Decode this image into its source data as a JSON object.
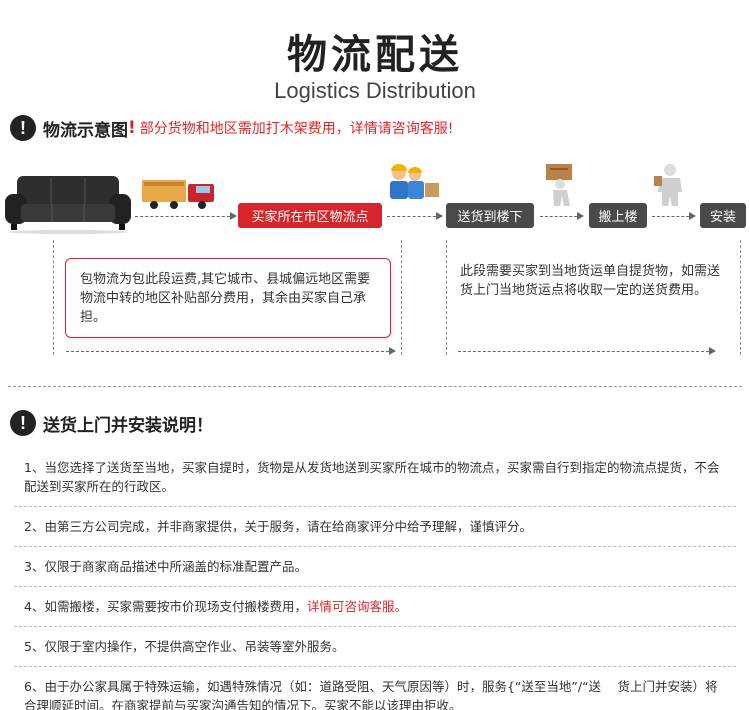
{
  "header": {
    "title": "物流配送",
    "subtitle": "Logistics Distribution"
  },
  "section1": {
    "title": "物流示意图",
    "exclaim": "!",
    "note": "部分货物和地区需加打木架费用，详情请咨询客服!"
  },
  "flow": {
    "step1": "买家所在市区物流点",
    "step2": "送货到楼下",
    "step3": "搬上楼",
    "step4": "安装"
  },
  "left_box": {
    "text": "包物流为包此段运费,其它城市、县城偏远地区需要物流中转的地区补贴部分费用，其余由买家自己承担。"
  },
  "right_box": {
    "text": "此段需要买家到当地货运单自提货物，如需送货上门当地货运点将收取一定的送货费用。"
  },
  "section2": {
    "title": "送货上门并安装说明！"
  },
  "notes": [
    {
      "text": "1、当您选择了送货至当地，买家自提时，货物是从发货地送到买家所在城市的物流点，买家需自行到指定的物流点提货，不会配送到买家所在的行政区。"
    },
    {
      "text": "2、由第三方公司完成，并非商家提供，关于服务，请在给商家评分中给予理解，谨慎评分。"
    },
    {
      "text": "3、仅限于商家商品描述中所涵盖的标准配置产品。"
    },
    {
      "text": "4、如需搬楼，买家需要按市价现场支付搬楼费用，",
      "red": "详情可咨询客服。"
    },
    {
      "text": "5、仅限于室内操作，不提供高空作业、吊装等室外服务。"
    },
    {
      "text": "6、由于办公家具属于特殊运输，如遇特殊情况（如：道路受阻、天气原因等）时，服务{“送至当地”/“送　 货上门并安装）将合理顺延时间。在商家提前与买家沟通告知的情况下。买家不能以该理由拒收。"
    }
  ],
  "colors": {
    "accent_red": "#d7262b",
    "pill_gray": "#4a4a4a"
  },
  "icons": [
    "sofa-icon",
    "truck-icon",
    "workers-icon",
    "porter-icon",
    "installer-icon",
    "warning-icon"
  ]
}
